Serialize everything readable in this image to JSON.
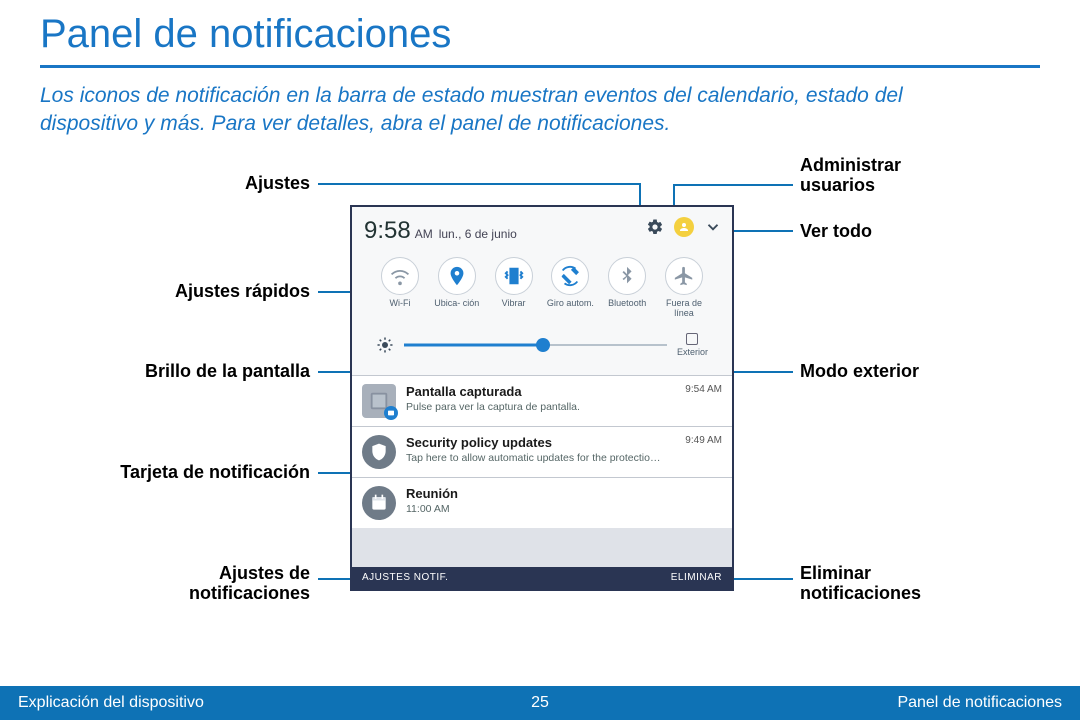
{
  "page": {
    "title": "Panel de notificaciones",
    "intro": "Los iconos de notificación en la barra de estado muestran eventos del calendario, estado del dispositivo y más. Para ver detalles, abra el panel de notificaciones.",
    "footer_left": "Explicación del dispositivo",
    "footer_page": "25",
    "footer_right": "Panel de notificaciones"
  },
  "callouts": {
    "ajustes": "Ajustes",
    "administrar_usuarios": "Administrar usuarios",
    "ver_todo": "Ver todo",
    "ajustes_rapidos": "Ajustes rápidos",
    "brillo": "Brillo de la pantalla",
    "modo_exterior": "Modo exterior",
    "tarjeta": "Tarjeta de notificación",
    "ajustes_notif": "Ajustes de notificaciones",
    "eliminar_notif": "Eliminar notificaciones"
  },
  "status": {
    "time": "9:58",
    "ampm": "AM",
    "date": "lun., 6 de junio"
  },
  "quick_settings": [
    {
      "name": "wifi",
      "label": "Wi-Fi"
    },
    {
      "name": "location",
      "label": "Ubica- ción"
    },
    {
      "name": "vibrate",
      "label": "Vibrar"
    },
    {
      "name": "autorotate",
      "label": "Giro autom."
    },
    {
      "name": "bluetooth",
      "label": "Bluetooth"
    },
    {
      "name": "airplane",
      "label": "Fuera de línea"
    }
  ],
  "brightness": {
    "exterior_label": "Exterior"
  },
  "notifications": [
    {
      "title": "Pantalla capturada",
      "sub": "Pulse para ver la captura de pantalla.",
      "time": "9:54 AM"
    },
    {
      "title": "Security policy updates",
      "sub": "Tap here to allow automatic updates for the protection of your..",
      "time": "9:49 AM"
    },
    {
      "title": "Reunión",
      "sub": "11:00 AM",
      "time": ""
    }
  ],
  "panel_footer": {
    "left": "AJUSTES NOTIF.",
    "right": "ELIMINAR"
  }
}
